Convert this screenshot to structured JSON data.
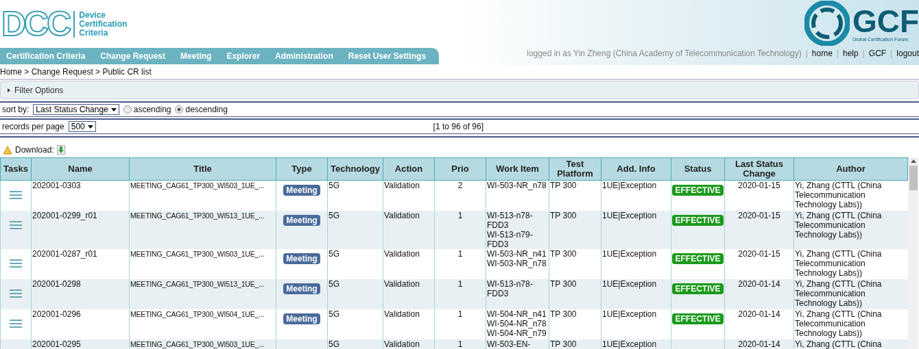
{
  "logo": {
    "mark": "DCC",
    "lines": [
      "Device",
      "Certification",
      "Criteria"
    ]
  },
  "partner_logo": {
    "mark": "GCF",
    "caption": "Global Certification Forum"
  },
  "nav": [
    {
      "label": "Certification Criteria"
    },
    {
      "label": "Change Request"
    },
    {
      "label": "Meeting"
    },
    {
      "label": "Explorer"
    },
    {
      "label": "Administration"
    },
    {
      "label": "Reset User Settings"
    }
  ],
  "user_bar": {
    "logged_in": "logged in as Yin Zheng (China Academy of Telecommunication Technology)",
    "links": [
      "home",
      "help",
      "GCF",
      "logout"
    ],
    "separator": "|"
  },
  "breadcrumb": "Home > Change Request > Public CR list",
  "filter": {
    "label": "Filter Options",
    "expanded": false
  },
  "sort": {
    "label": "sort by:",
    "value": "Last Status Change",
    "orders": [
      {
        "label": "ascending",
        "selected": false
      },
      {
        "label": "descending",
        "selected": true
      }
    ]
  },
  "paging": {
    "label": "records per page",
    "value": "500",
    "range": "[1 to 96 of 96]"
  },
  "download": {
    "label": "Download:"
  },
  "table": {
    "columns": [
      "Tasks",
      "Name",
      "Title",
      "Type",
      "Technology",
      "Action",
      "Prio",
      "Work Item",
      "Test Platform",
      "Add. Info",
      "Status",
      "Last Status Change",
      "Author"
    ],
    "rows": [
      {
        "name": "202001-0303",
        "title": "MEETING_CAG61_TP300_WI503_1UE_...",
        "type": "Meeting",
        "technology": "5G",
        "action": "Validation",
        "prio": "2",
        "work_item": [
          "WI-503-NR_n78"
        ],
        "test_platform": "TP 300",
        "add_info": "1UE|Exception",
        "status": "EFFECTIVE",
        "last_change": "2020-01-15",
        "author": "Yi, Zhang (CTTL (China Telecommunication Technology Labs))"
      },
      {
        "name": "202001-0299_r01",
        "title": "MEETING_CAG61_TP300_WI513_1UE_...",
        "type": "Meeting",
        "technology": "5G",
        "action": "Validation",
        "prio": "1",
        "work_item": [
          "WI-513-n78-FDD3",
          "WI-513-n79-FDD3"
        ],
        "test_platform": "TP 300",
        "add_info": "1UE|Exception",
        "status": "EFFECTIVE",
        "last_change": "2020-01-15",
        "author": "Yi, Zhang (CTTL (China Telecommunication Technology Labs))"
      },
      {
        "name": "202001-0287_r01",
        "title": "MEETING_CAG61_TP300_WI503_1UE_...",
        "type": "Meeting",
        "technology": "5G",
        "action": "Validation",
        "prio": "1",
        "work_item": [
          "WI-503-NR_n41",
          "WI-503-NR_n78"
        ],
        "test_platform": "TP 300",
        "add_info": "1UE|Exception",
        "status": "EFFECTIVE",
        "last_change": "2020-01-15",
        "author": "Yi, Zhang (CTTL (China Telecommunication Technology Labs))"
      },
      {
        "name": "202001-0298",
        "title": "MEETING_CAG61_TP300_WI513_1UE_...",
        "type": "Meeting",
        "technology": "5G",
        "action": "Validation",
        "prio": "1",
        "work_item": [
          "WI-513-n78-FDD3"
        ],
        "test_platform": "TP 300",
        "add_info": "1UE|Exception",
        "status": "EFFECTIVE",
        "last_change": "2020-01-14",
        "author": "Yi, Zhang (CTTL (China Telecommunication Technology Labs))"
      },
      {
        "name": "202001-0296",
        "title": "MEETING_CAG61_TP300_WI504_1UE_...",
        "type": "Meeting",
        "technology": "5G",
        "action": "Validation",
        "prio": "1",
        "work_item": [
          "WI-504-NR_n41",
          "WI-504-NR_n78",
          "WI-504-NR_n79"
        ],
        "test_platform": "TP 300",
        "add_info": "1UE|Exception",
        "status": "EFFECTIVE",
        "last_change": "2020-01-14",
        "author": "Yi, Zhang (CTTL (China Telecommunication Technology Labs))"
      },
      {
        "name": "202001-0295",
        "title": "MEETING_CAG61_TP300_WI503_1UE_...",
        "technology": "5G",
        "action": "Validation",
        "prio": "1",
        "work_item": [
          "WI-503-EN-"
        ],
        "test_platform": "TP 300",
        "add_info": "1UE|Exception",
        "last_change": "2020-01-14",
        "author": "Yi, Zhang (CTTL (China"
      }
    ]
  }
}
